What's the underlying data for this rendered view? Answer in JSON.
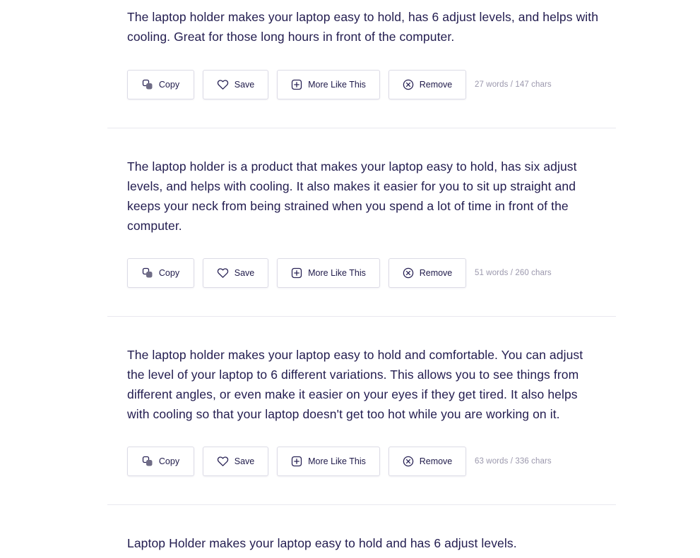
{
  "actions": {
    "copy_label": "Copy",
    "save_label": "Save",
    "more_label": "More Like This",
    "remove_label": "Remove"
  },
  "results": [
    {
      "text": "The laptop holder makes your laptop easy to hold, has 6 adjust levels, and helps with cooling. Great for those long hours in front of the computer.",
      "count": "27 words / 147 chars"
    },
    {
      "text": "The laptop holder is a product that makes your laptop easy to hold, has six adjust levels, and helps with cooling. It also makes it easier for you to sit up straight and keeps your neck from being strained when you spend a lot of time in front of the computer.",
      "count": "51 words / 260 chars"
    },
    {
      "text": "The laptop holder makes your laptop easy to hold and comfortable. You can adjust the level of your laptop to 6 different variations. This allows you to see things from different angles, or even make it easier on your eyes if they get tired. It also helps with cooling so that your laptop doesn't get too hot while you are working on it.",
      "count": "63 words / 336 chars"
    },
    {
      "text": "Laptop Holder makes your laptop easy to hold and has 6 adjust levels."
    }
  ],
  "icons": {
    "copy": "copy-icon",
    "save": "heart-icon",
    "more": "plus-square-icon",
    "remove": "close-circle-icon"
  },
  "colors": {
    "text": "#221c4f",
    "count": "#9b98ad",
    "border": "#dcdbe6",
    "divider": "#e9e8ef"
  }
}
